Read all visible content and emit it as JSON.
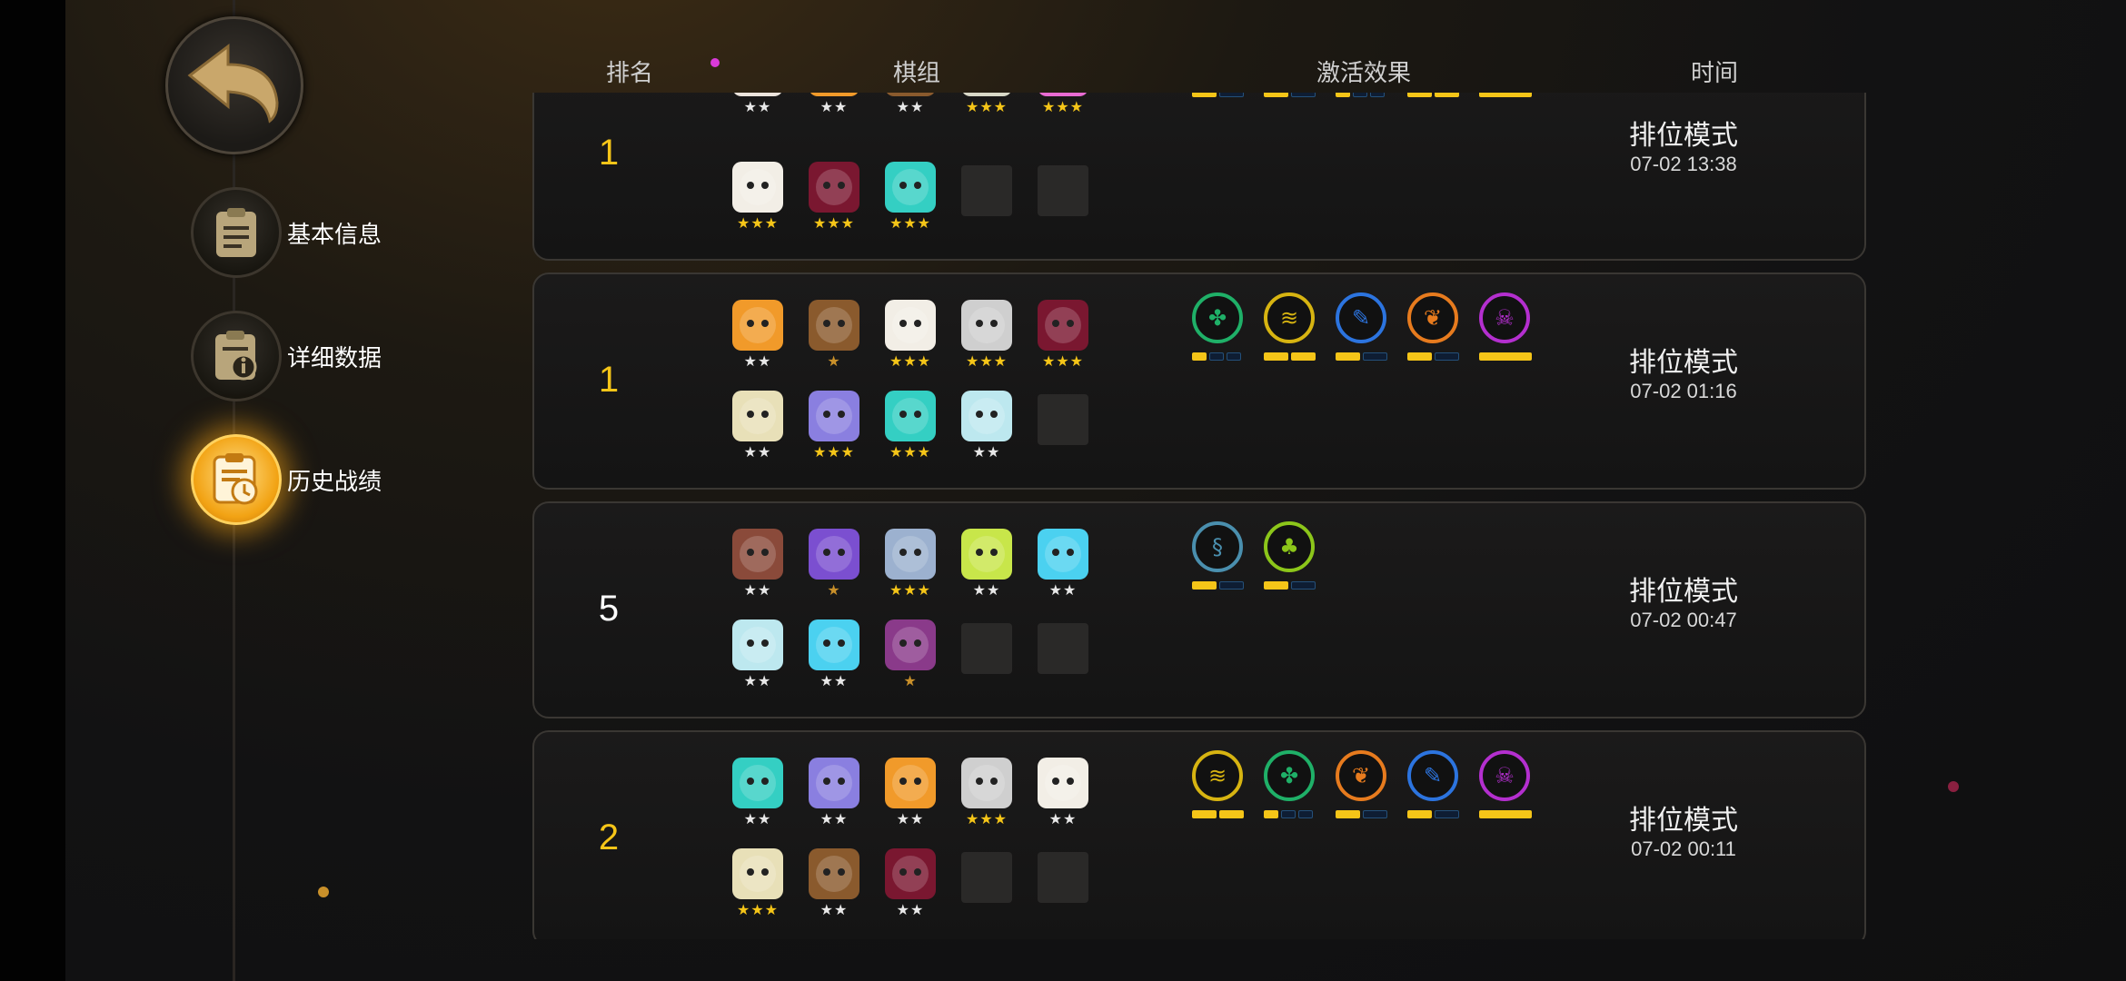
{
  "nav": {
    "back_icon": "undo-arrow-icon",
    "items": [
      {
        "label": "基本信息",
        "icon": "clipboard-icon",
        "active": false
      },
      {
        "label": "详细数据",
        "icon": "clipboard-info-icon",
        "active": false
      },
      {
        "label": "历史战绩",
        "icon": "clipboard-clock-icon",
        "active": true
      }
    ]
  },
  "headers": {
    "rank": "排名",
    "team": "棋组",
    "effects": "激活效果",
    "time": "时间"
  },
  "colors": {
    "rank_gold": "#f5c518",
    "rank_white": "#ffffff",
    "bar_on": "#f5c518",
    "bar_off": "#0e1d33"
  },
  "matches": [
    {
      "rank": "1",
      "rank_color": "#f5c518",
      "mode": "排位模式",
      "time": "07-02 13:38",
      "pieces": [
        {
          "color": "#ece4dd",
          "stars": "★★"
        },
        {
          "color": "#f19a2a",
          "stars": "★★"
        },
        {
          "color": "#8a5a2d",
          "stars": "★★"
        },
        {
          "color": "#d9d9c8",
          "stars": "★★★"
        },
        {
          "color": "#e86bd3",
          "stars": "★★★"
        },
        {
          "color": "#f2eee6",
          "stars": "★★★"
        },
        {
          "color": "#7a1730",
          "stars": "★★★"
        },
        {
          "color": "#34cfc3",
          "stars": "★★★"
        },
        {
          "empty": true
        },
        {
          "empty": true
        }
      ],
      "traits": [
        {
          "icon": "leaf-icon",
          "color": "#e77b1e",
          "bars": [
            1,
            0
          ]
        },
        {
          "icon": "feather-icon",
          "color": "#2c74df",
          "bars": [
            1,
            0
          ]
        },
        {
          "icon": "paw-icon",
          "color": "#1fb068",
          "bars": [
            1,
            0,
            0
          ]
        },
        {
          "icon": "claw-icon",
          "color": "#d7b411",
          "bars": [
            1,
            1
          ]
        },
        {
          "icon": "skull-icon",
          "color": "#b42fcf",
          "bars": [
            1
          ]
        }
      ]
    },
    {
      "rank": "1",
      "rank_color": "#f5c518",
      "mode": "排位模式",
      "time": "07-02 01:16",
      "pieces": [
        {
          "color": "#f19a2a",
          "stars": "★★"
        },
        {
          "color": "#8a5a2d",
          "stars": "★",
          "gold": true
        },
        {
          "color": "#f2eee6",
          "stars": "★★★"
        },
        {
          "color": "#cfcfcf",
          "stars": "★★★"
        },
        {
          "color": "#7a1730",
          "stars": "★★★"
        },
        {
          "color": "#e8e0b8",
          "stars": "★★"
        },
        {
          "color": "#8a7fe0",
          "stars": "★★★"
        },
        {
          "color": "#34cfc3",
          "stars": "★★★"
        },
        {
          "color": "#bde8ef",
          "stars": "★★"
        },
        {
          "empty": true
        }
      ],
      "traits": [
        {
          "icon": "paw-icon",
          "color": "#1fb068",
          "bars": [
            1,
            0,
            0
          ]
        },
        {
          "icon": "claw-icon",
          "color": "#d7b411",
          "bars": [
            1,
            1
          ]
        },
        {
          "icon": "feather-icon",
          "color": "#2c74df",
          "bars": [
            1,
            0
          ]
        },
        {
          "icon": "leaf-icon",
          "color": "#e77b1e",
          "bars": [
            1,
            0
          ]
        },
        {
          "icon": "skull-icon",
          "color": "#b42fcf",
          "bars": [
            1
          ]
        }
      ]
    },
    {
      "rank": "5",
      "rank_color": "#ffffff",
      "mode": "排位模式",
      "time": "07-02 00:47",
      "pieces": [
        {
          "color": "#8a4a3a",
          "stars": "★★"
        },
        {
          "color": "#7b4fd0",
          "stars": "★",
          "gold": true
        },
        {
          "color": "#9cb1cf",
          "stars": "★★★"
        },
        {
          "color": "#c8e64a",
          "stars": "★★"
        },
        {
          "color": "#4bd1f0",
          "stars": "★★"
        },
        {
          "color": "#bde8ef",
          "stars": "★★"
        },
        {
          "color": "#4bd1f0",
          "stars": "★★"
        },
        {
          "color": "#8a3a8a",
          "stars": "★",
          "gold": true
        },
        {
          "empty": true
        },
        {
          "empty": true
        }
      ],
      "traits": [
        {
          "icon": "swirl-icon",
          "color": "#4a8fae",
          "bars": [
            1,
            0
          ]
        },
        {
          "icon": "clover-icon",
          "color": "#8cc61a",
          "bars": [
            1,
            0
          ]
        }
      ]
    },
    {
      "rank": "2",
      "rank_color": "#f5c518",
      "mode": "排位模式",
      "time": "07-02 00:11",
      "pieces": [
        {
          "color": "#34cfc3",
          "stars": "★★"
        },
        {
          "color": "#8a7fe0",
          "stars": "★★"
        },
        {
          "color": "#f19a2a",
          "stars": "★★"
        },
        {
          "color": "#cfcfcf",
          "stars": "★★★"
        },
        {
          "color": "#f2eee6",
          "stars": "★★"
        },
        {
          "color": "#e8e0b8",
          "stars": "★★★"
        },
        {
          "color": "#8a5a2d",
          "stars": "★★"
        },
        {
          "color": "#7a1730",
          "stars": "★★"
        },
        {
          "empty": true
        },
        {
          "empty": true
        }
      ],
      "traits": [
        {
          "icon": "claw-icon",
          "color": "#d7b411",
          "bars": [
            1,
            1
          ]
        },
        {
          "icon": "paw-icon",
          "color": "#1fb068",
          "bars": [
            1,
            0,
            0
          ]
        },
        {
          "icon": "leaf-icon",
          "color": "#e77b1e",
          "bars": [
            1,
            0
          ]
        },
        {
          "icon": "feather-icon",
          "color": "#2c74df",
          "bars": [
            1,
            0
          ]
        },
        {
          "icon": "skull-icon",
          "color": "#b42fcf",
          "bars": [
            1
          ]
        }
      ]
    }
  ]
}
